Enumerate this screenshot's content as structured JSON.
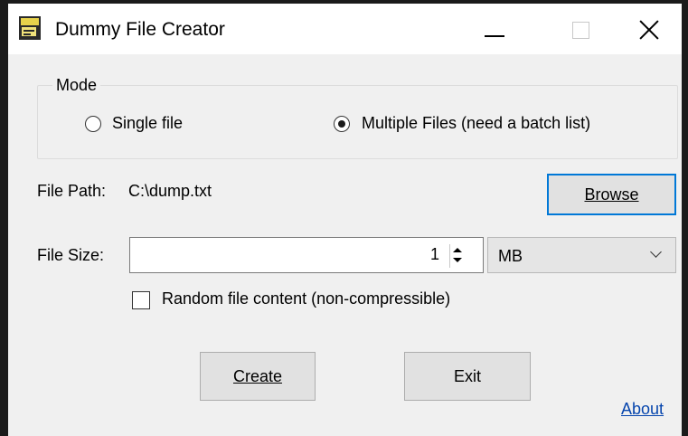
{
  "window": {
    "title": "Dummy File Creator"
  },
  "mode": {
    "group_label": "Mode",
    "options": [
      {
        "label": "Single file",
        "selected": false
      },
      {
        "label": "Multiple Files (need a batch list)",
        "selected": true
      }
    ]
  },
  "file_path": {
    "label": "File Path:",
    "value": "C:\\dump.txt",
    "browse_label": "Browse"
  },
  "file_size": {
    "label": "File Size:",
    "value": "1",
    "unit": "MB"
  },
  "random_content": {
    "label": "Random file content (non-compressible)",
    "checked": false
  },
  "actions": {
    "create_label": "Create",
    "exit_label": "Exit",
    "about_label": "About"
  }
}
